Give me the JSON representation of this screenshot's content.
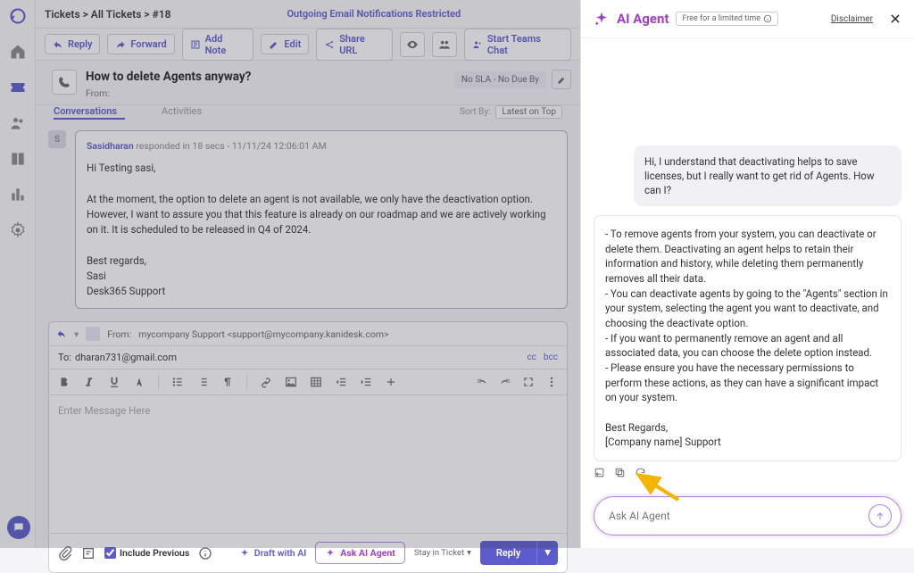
{
  "breadcrumb": "Tickets > All Tickets > #18",
  "notice": "Outgoing Email Notifications Restricted",
  "toolbar": {
    "reply": "Reply",
    "forward": "Forward",
    "add_note": "Add Note",
    "edit": "Edit",
    "share_url": "Share URL",
    "start_teams": "Start Teams Chat"
  },
  "ticket": {
    "title": "How to delete Agents anyway?",
    "from_label": "From:",
    "sla_badge": "No SLA - No Due By"
  },
  "tabs": {
    "conversations": "Conversations",
    "activities": "Activities",
    "sort_by": "Sort By:",
    "sort_value": "Latest on Top"
  },
  "thread": {
    "avatar_letter": "S",
    "name": "Sasidharan",
    "responded": "responded in 18 secs  -  11/11/24 12:06:01 AM",
    "body": "Hi Testing sasi,\n\nAt the moment, the option to delete an agent is not available, we only have the deactivation option. However, I want to assure you that this feature is already on our roadmap and we are actively working on it. It is scheduled to be released in Q4 of 2024.\n\nBest regards,\nSasi\nDesk365 Support"
  },
  "composer": {
    "from_label": "From:",
    "from_value": "mycompany Support <support@mycompany.kanidesk.com>",
    "to_label": "To:",
    "to_value": "dharan731@gmail.com",
    "cc": "cc",
    "bcc": "bcc",
    "placeholder": "Enter Message Here",
    "include_previous": "Include Previous",
    "draft_ai": "Draft with AI",
    "ask_ai": "Ask AI Agent",
    "stay_ticket": "Stay in Ticket",
    "reply_btn": "Reply"
  },
  "ai": {
    "title": "AI Agent",
    "free_badge": "Free for a limited time",
    "disclaimer": "Disclaimer",
    "user_msg": "Hi, I understand that deactivating helps to save licenses, but I really want to get rid of Agents. How can I?",
    "agent_msg": "- To remove agents from your system, you can deactivate or delete them. Deactivating an agent helps to retain their information and history, while deleting them permanently removes all their data.\n- You can deactivate agents by going to the \"Agents\" section in your system, selecting the agent you want to deactivate, and choosing the deactivate option.\n- If you want to permanently remove an agent and all associated data, you can choose the delete option instead.\n- Please ensure you have the necessary permissions to perform these actions, as they can have a significant impact on your system.\n\nBest Regards,\n[Company name] Support",
    "input_placeholder": "Ask AI Agent"
  }
}
